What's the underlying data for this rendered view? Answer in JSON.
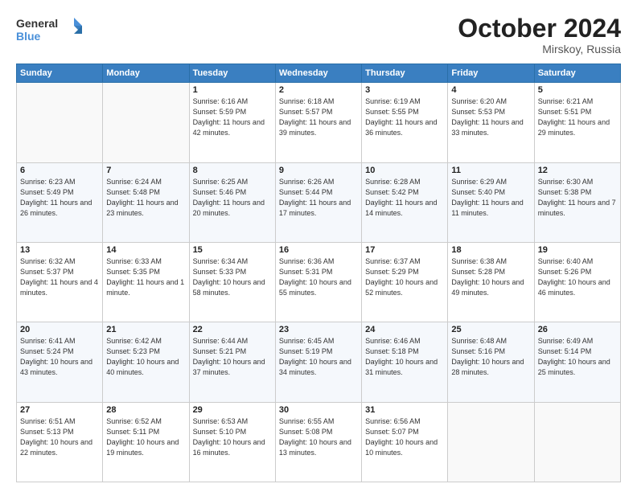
{
  "header": {
    "logo_line1": "General",
    "logo_line2": "Blue",
    "month": "October 2024",
    "location": "Mirskoy, Russia"
  },
  "days_of_week": [
    "Sunday",
    "Monday",
    "Tuesday",
    "Wednesday",
    "Thursday",
    "Friday",
    "Saturday"
  ],
  "weeks": [
    [
      {
        "day": "",
        "sunrise": "",
        "sunset": "",
        "daylight": ""
      },
      {
        "day": "",
        "sunrise": "",
        "sunset": "",
        "daylight": ""
      },
      {
        "day": "1",
        "sunrise": "Sunrise: 6:16 AM",
        "sunset": "Sunset: 5:59 PM",
        "daylight": "Daylight: 11 hours and 42 minutes."
      },
      {
        "day": "2",
        "sunrise": "Sunrise: 6:18 AM",
        "sunset": "Sunset: 5:57 PM",
        "daylight": "Daylight: 11 hours and 39 minutes."
      },
      {
        "day": "3",
        "sunrise": "Sunrise: 6:19 AM",
        "sunset": "Sunset: 5:55 PM",
        "daylight": "Daylight: 11 hours and 36 minutes."
      },
      {
        "day": "4",
        "sunrise": "Sunrise: 6:20 AM",
        "sunset": "Sunset: 5:53 PM",
        "daylight": "Daylight: 11 hours and 33 minutes."
      },
      {
        "day": "5",
        "sunrise": "Sunrise: 6:21 AM",
        "sunset": "Sunset: 5:51 PM",
        "daylight": "Daylight: 11 hours and 29 minutes."
      }
    ],
    [
      {
        "day": "6",
        "sunrise": "Sunrise: 6:23 AM",
        "sunset": "Sunset: 5:49 PM",
        "daylight": "Daylight: 11 hours and 26 minutes."
      },
      {
        "day": "7",
        "sunrise": "Sunrise: 6:24 AM",
        "sunset": "Sunset: 5:48 PM",
        "daylight": "Daylight: 11 hours and 23 minutes."
      },
      {
        "day": "8",
        "sunrise": "Sunrise: 6:25 AM",
        "sunset": "Sunset: 5:46 PM",
        "daylight": "Daylight: 11 hours and 20 minutes."
      },
      {
        "day": "9",
        "sunrise": "Sunrise: 6:26 AM",
        "sunset": "Sunset: 5:44 PM",
        "daylight": "Daylight: 11 hours and 17 minutes."
      },
      {
        "day": "10",
        "sunrise": "Sunrise: 6:28 AM",
        "sunset": "Sunset: 5:42 PM",
        "daylight": "Daylight: 11 hours and 14 minutes."
      },
      {
        "day": "11",
        "sunrise": "Sunrise: 6:29 AM",
        "sunset": "Sunset: 5:40 PM",
        "daylight": "Daylight: 11 hours and 11 minutes."
      },
      {
        "day": "12",
        "sunrise": "Sunrise: 6:30 AM",
        "sunset": "Sunset: 5:38 PM",
        "daylight": "Daylight: 11 hours and 7 minutes."
      }
    ],
    [
      {
        "day": "13",
        "sunrise": "Sunrise: 6:32 AM",
        "sunset": "Sunset: 5:37 PM",
        "daylight": "Daylight: 11 hours and 4 minutes."
      },
      {
        "day": "14",
        "sunrise": "Sunrise: 6:33 AM",
        "sunset": "Sunset: 5:35 PM",
        "daylight": "Daylight: 11 hours and 1 minute."
      },
      {
        "day": "15",
        "sunrise": "Sunrise: 6:34 AM",
        "sunset": "Sunset: 5:33 PM",
        "daylight": "Daylight: 10 hours and 58 minutes."
      },
      {
        "day": "16",
        "sunrise": "Sunrise: 6:36 AM",
        "sunset": "Sunset: 5:31 PM",
        "daylight": "Daylight: 10 hours and 55 minutes."
      },
      {
        "day": "17",
        "sunrise": "Sunrise: 6:37 AM",
        "sunset": "Sunset: 5:29 PM",
        "daylight": "Daylight: 10 hours and 52 minutes."
      },
      {
        "day": "18",
        "sunrise": "Sunrise: 6:38 AM",
        "sunset": "Sunset: 5:28 PM",
        "daylight": "Daylight: 10 hours and 49 minutes."
      },
      {
        "day": "19",
        "sunrise": "Sunrise: 6:40 AM",
        "sunset": "Sunset: 5:26 PM",
        "daylight": "Daylight: 10 hours and 46 minutes."
      }
    ],
    [
      {
        "day": "20",
        "sunrise": "Sunrise: 6:41 AM",
        "sunset": "Sunset: 5:24 PM",
        "daylight": "Daylight: 10 hours and 43 minutes."
      },
      {
        "day": "21",
        "sunrise": "Sunrise: 6:42 AM",
        "sunset": "Sunset: 5:23 PM",
        "daylight": "Daylight: 10 hours and 40 minutes."
      },
      {
        "day": "22",
        "sunrise": "Sunrise: 6:44 AM",
        "sunset": "Sunset: 5:21 PM",
        "daylight": "Daylight: 10 hours and 37 minutes."
      },
      {
        "day": "23",
        "sunrise": "Sunrise: 6:45 AM",
        "sunset": "Sunset: 5:19 PM",
        "daylight": "Daylight: 10 hours and 34 minutes."
      },
      {
        "day": "24",
        "sunrise": "Sunrise: 6:46 AM",
        "sunset": "Sunset: 5:18 PM",
        "daylight": "Daylight: 10 hours and 31 minutes."
      },
      {
        "day": "25",
        "sunrise": "Sunrise: 6:48 AM",
        "sunset": "Sunset: 5:16 PM",
        "daylight": "Daylight: 10 hours and 28 minutes."
      },
      {
        "day": "26",
        "sunrise": "Sunrise: 6:49 AM",
        "sunset": "Sunset: 5:14 PM",
        "daylight": "Daylight: 10 hours and 25 minutes."
      }
    ],
    [
      {
        "day": "27",
        "sunrise": "Sunrise: 6:51 AM",
        "sunset": "Sunset: 5:13 PM",
        "daylight": "Daylight: 10 hours and 22 minutes."
      },
      {
        "day": "28",
        "sunrise": "Sunrise: 6:52 AM",
        "sunset": "Sunset: 5:11 PM",
        "daylight": "Daylight: 10 hours and 19 minutes."
      },
      {
        "day": "29",
        "sunrise": "Sunrise: 6:53 AM",
        "sunset": "Sunset: 5:10 PM",
        "daylight": "Daylight: 10 hours and 16 minutes."
      },
      {
        "day": "30",
        "sunrise": "Sunrise: 6:55 AM",
        "sunset": "Sunset: 5:08 PM",
        "daylight": "Daylight: 10 hours and 13 minutes."
      },
      {
        "day": "31",
        "sunrise": "Sunrise: 6:56 AM",
        "sunset": "Sunset: 5:07 PM",
        "daylight": "Daylight: 10 hours and 10 minutes."
      },
      {
        "day": "",
        "sunrise": "",
        "sunset": "",
        "daylight": ""
      },
      {
        "day": "",
        "sunrise": "",
        "sunset": "",
        "daylight": ""
      }
    ]
  ]
}
